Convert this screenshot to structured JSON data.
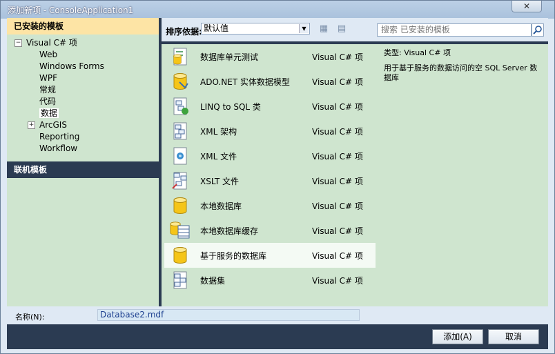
{
  "window": {
    "title": "添加新项 - ConsoleApplication1",
    "close_label": "✕"
  },
  "left": {
    "installed_header": "已安装的模板",
    "online_header": "联机模板",
    "tree": [
      {
        "label": "Visual C# 项",
        "expander": "−"
      },
      {
        "label": "Web"
      },
      {
        "label": "Windows Forms"
      },
      {
        "label": "WPF"
      },
      {
        "label": "常规"
      },
      {
        "label": "代码"
      },
      {
        "label": "数据",
        "selected": true
      },
      {
        "label": "ArcGIS",
        "expander": "+"
      },
      {
        "label": "Reporting"
      },
      {
        "label": "Workflow"
      }
    ]
  },
  "sort": {
    "label": "排序依据:",
    "value": "默认值"
  },
  "templates": [
    {
      "name": "数据库单元测试",
      "kind": "Visual C# 项",
      "icon": "database-unit-test-icon"
    },
    {
      "name": "ADO.NET 实体数据模型",
      "kind": "Visual C# 项",
      "icon": "entity-model-icon"
    },
    {
      "name": "LINQ to SQL 类",
      "kind": "Visual C# 项",
      "icon": "linq-to-sql-icon"
    },
    {
      "name": "XML 架构",
      "kind": "Visual C# 项",
      "icon": "xml-schema-icon"
    },
    {
      "name": "XML 文件",
      "kind": "Visual C# 项",
      "icon": "xml-file-icon"
    },
    {
      "name": "XSLT 文件",
      "kind": "Visual C# 项",
      "icon": "xslt-file-icon"
    },
    {
      "name": "本地数据库",
      "kind": "Visual C# 项",
      "icon": "local-database-icon"
    },
    {
      "name": "本地数据库缓存",
      "kind": "Visual C# 项",
      "icon": "local-database-cache-icon"
    },
    {
      "name": "基于服务的数据库",
      "kind": "Visual C# 项",
      "icon": "service-database-icon",
      "selected": true
    },
    {
      "name": "数据集",
      "kind": "Visual C# 项",
      "icon": "dataset-icon"
    }
  ],
  "search": {
    "placeholder": "搜索 已安装的模板"
  },
  "details": {
    "type_label": "类型:",
    "type_value": "Visual C# 项",
    "description": "用于基于服务的数据访问的空 SQL Server 数据库"
  },
  "name_field": {
    "label": "名称(N):",
    "value": "Database2.mdf"
  },
  "buttons": {
    "add": "添加(A)",
    "cancel": "取消"
  },
  "colors": {
    "accent_header": "#fde4a5",
    "pane_bg": "#cfe5cf",
    "dark_chrome": "#2b3b52"
  }
}
